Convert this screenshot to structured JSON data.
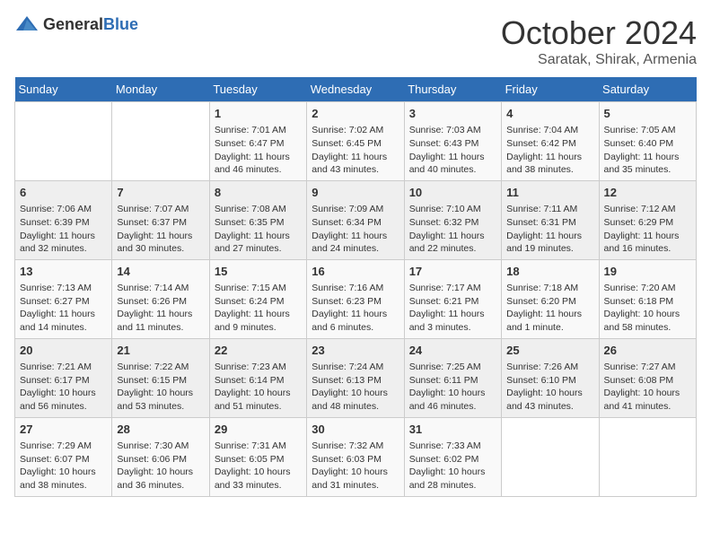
{
  "header": {
    "logo_general": "General",
    "logo_blue": "Blue",
    "month": "October 2024",
    "location": "Saratak, Shirak, Armenia"
  },
  "weekdays": [
    "Sunday",
    "Monday",
    "Tuesday",
    "Wednesday",
    "Thursday",
    "Friday",
    "Saturday"
  ],
  "weeks": [
    [
      {
        "day": "",
        "info": ""
      },
      {
        "day": "",
        "info": ""
      },
      {
        "day": "1",
        "info": "Sunrise: 7:01 AM\nSunset: 6:47 PM\nDaylight: 11 hours and 46 minutes."
      },
      {
        "day": "2",
        "info": "Sunrise: 7:02 AM\nSunset: 6:45 PM\nDaylight: 11 hours and 43 minutes."
      },
      {
        "day": "3",
        "info": "Sunrise: 7:03 AM\nSunset: 6:43 PM\nDaylight: 11 hours and 40 minutes."
      },
      {
        "day": "4",
        "info": "Sunrise: 7:04 AM\nSunset: 6:42 PM\nDaylight: 11 hours and 38 minutes."
      },
      {
        "day": "5",
        "info": "Sunrise: 7:05 AM\nSunset: 6:40 PM\nDaylight: 11 hours and 35 minutes."
      }
    ],
    [
      {
        "day": "6",
        "info": "Sunrise: 7:06 AM\nSunset: 6:39 PM\nDaylight: 11 hours and 32 minutes."
      },
      {
        "day": "7",
        "info": "Sunrise: 7:07 AM\nSunset: 6:37 PM\nDaylight: 11 hours and 30 minutes."
      },
      {
        "day": "8",
        "info": "Sunrise: 7:08 AM\nSunset: 6:35 PM\nDaylight: 11 hours and 27 minutes."
      },
      {
        "day": "9",
        "info": "Sunrise: 7:09 AM\nSunset: 6:34 PM\nDaylight: 11 hours and 24 minutes."
      },
      {
        "day": "10",
        "info": "Sunrise: 7:10 AM\nSunset: 6:32 PM\nDaylight: 11 hours and 22 minutes."
      },
      {
        "day": "11",
        "info": "Sunrise: 7:11 AM\nSunset: 6:31 PM\nDaylight: 11 hours and 19 minutes."
      },
      {
        "day": "12",
        "info": "Sunrise: 7:12 AM\nSunset: 6:29 PM\nDaylight: 11 hours and 16 minutes."
      }
    ],
    [
      {
        "day": "13",
        "info": "Sunrise: 7:13 AM\nSunset: 6:27 PM\nDaylight: 11 hours and 14 minutes."
      },
      {
        "day": "14",
        "info": "Sunrise: 7:14 AM\nSunset: 6:26 PM\nDaylight: 11 hours and 11 minutes."
      },
      {
        "day": "15",
        "info": "Sunrise: 7:15 AM\nSunset: 6:24 PM\nDaylight: 11 hours and 9 minutes."
      },
      {
        "day": "16",
        "info": "Sunrise: 7:16 AM\nSunset: 6:23 PM\nDaylight: 11 hours and 6 minutes."
      },
      {
        "day": "17",
        "info": "Sunrise: 7:17 AM\nSunset: 6:21 PM\nDaylight: 11 hours and 3 minutes."
      },
      {
        "day": "18",
        "info": "Sunrise: 7:18 AM\nSunset: 6:20 PM\nDaylight: 11 hours and 1 minute."
      },
      {
        "day": "19",
        "info": "Sunrise: 7:20 AM\nSunset: 6:18 PM\nDaylight: 10 hours and 58 minutes."
      }
    ],
    [
      {
        "day": "20",
        "info": "Sunrise: 7:21 AM\nSunset: 6:17 PM\nDaylight: 10 hours and 56 minutes."
      },
      {
        "day": "21",
        "info": "Sunrise: 7:22 AM\nSunset: 6:15 PM\nDaylight: 10 hours and 53 minutes."
      },
      {
        "day": "22",
        "info": "Sunrise: 7:23 AM\nSunset: 6:14 PM\nDaylight: 10 hours and 51 minutes."
      },
      {
        "day": "23",
        "info": "Sunrise: 7:24 AM\nSunset: 6:13 PM\nDaylight: 10 hours and 48 minutes."
      },
      {
        "day": "24",
        "info": "Sunrise: 7:25 AM\nSunset: 6:11 PM\nDaylight: 10 hours and 46 minutes."
      },
      {
        "day": "25",
        "info": "Sunrise: 7:26 AM\nSunset: 6:10 PM\nDaylight: 10 hours and 43 minutes."
      },
      {
        "day": "26",
        "info": "Sunrise: 7:27 AM\nSunset: 6:08 PM\nDaylight: 10 hours and 41 minutes."
      }
    ],
    [
      {
        "day": "27",
        "info": "Sunrise: 7:29 AM\nSunset: 6:07 PM\nDaylight: 10 hours and 38 minutes."
      },
      {
        "day": "28",
        "info": "Sunrise: 7:30 AM\nSunset: 6:06 PM\nDaylight: 10 hours and 36 minutes."
      },
      {
        "day": "29",
        "info": "Sunrise: 7:31 AM\nSunset: 6:05 PM\nDaylight: 10 hours and 33 minutes."
      },
      {
        "day": "30",
        "info": "Sunrise: 7:32 AM\nSunset: 6:03 PM\nDaylight: 10 hours and 31 minutes."
      },
      {
        "day": "31",
        "info": "Sunrise: 7:33 AM\nSunset: 6:02 PM\nDaylight: 10 hours and 28 minutes."
      },
      {
        "day": "",
        "info": ""
      },
      {
        "day": "",
        "info": ""
      }
    ]
  ]
}
